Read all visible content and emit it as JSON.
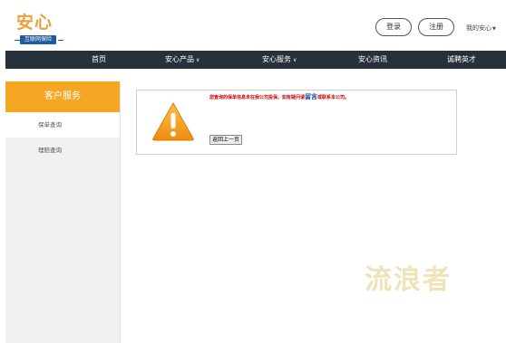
{
  "header": {
    "logo_text": "安心",
    "logo_sub": "互联网保险",
    "login_label": "登录",
    "register_label": "注册",
    "my_account_label": "我的安心",
    "my_account_caret": "▼"
  },
  "nav": {
    "items": [
      {
        "label": "首页"
      },
      {
        "label": "安心产品"
      },
      {
        "label": "安心服务"
      },
      {
        "label": "安心资讯"
      },
      {
        "label": "诚聘英才"
      }
    ]
  },
  "sidebar": {
    "title": "客户服务",
    "items": [
      {
        "label": "保单查询"
      },
      {
        "label": "理赔查询"
      }
    ]
  },
  "main": {
    "message_prefix": "您查询的保单信息未在我公司投保，如有疑问请",
    "message_link": "留言",
    "message_suffix": "或联系本公司。",
    "back_label": "返回上一页"
  },
  "watermark": "流浪者",
  "colors": {
    "brand": "#e9a23b",
    "nav_bg": "#28313a",
    "sidebar_head": "#f5a623",
    "warning": "#cc0000",
    "link": "#1f4ea0"
  }
}
